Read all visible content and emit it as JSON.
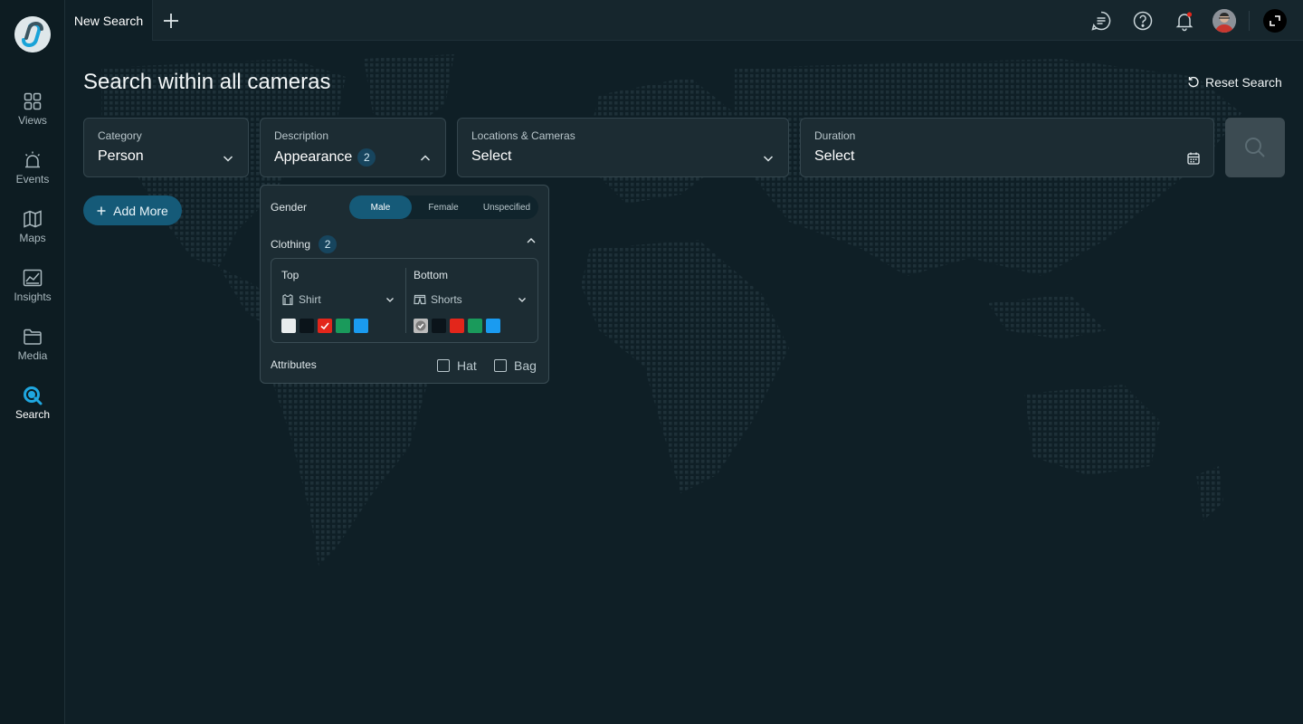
{
  "sidebar": {
    "items": [
      {
        "label": "Views",
        "icon": "grid-icon"
      },
      {
        "label": "Events",
        "icon": "alarm-icon"
      },
      {
        "label": "Maps",
        "icon": "map-icon"
      },
      {
        "label": "Insights",
        "icon": "chart-icon"
      },
      {
        "label": "Media",
        "icon": "folder-icon"
      },
      {
        "label": "Search",
        "icon": "search-icon"
      }
    ],
    "active": "Search"
  },
  "topbar": {
    "tab_label": "New Search",
    "icons": [
      "chat-icon",
      "help-icon",
      "bell-icon",
      "avatar",
      "expand-icon"
    ]
  },
  "main": {
    "title": "Search within all cameras",
    "reset_label": "Reset Search",
    "filters": {
      "category": {
        "label": "Category",
        "value": "Person"
      },
      "description": {
        "label": "Description",
        "value": "Appearance",
        "count": "2"
      },
      "locations": {
        "label": "Locations & Cameras",
        "value": "Select"
      },
      "duration": {
        "label": "Duration",
        "value": "Select"
      }
    },
    "add_more_label": "Add More"
  },
  "appearance_panel": {
    "gender": {
      "label": "Gender",
      "options": [
        "Male",
        "Female",
        "Unspecified"
      ],
      "selected": "Male"
    },
    "clothing": {
      "label": "Clothing",
      "count": "2",
      "top": {
        "label": "Top",
        "value": "Shirt",
        "colors": [
          "#e8eced",
          "#0b141a",
          "#e3261b",
          "#1a9a5b",
          "#1a9bf0"
        ],
        "selected_color": "#e3261b"
      },
      "bottom": {
        "label": "Bottom",
        "value": "Shorts",
        "colors": [
          "#bcbcbc",
          "#0b141a",
          "#e3261b",
          "#1a9a5b",
          "#1a9bf0"
        ],
        "selected_color": "#bcbcbc"
      }
    },
    "attributes": {
      "label": "Attributes",
      "options": [
        "Hat",
        "Bag"
      ]
    }
  },
  "colors": {
    "accent": "#155a78",
    "background": "#0f1f26",
    "panel": "#1c2c33"
  }
}
